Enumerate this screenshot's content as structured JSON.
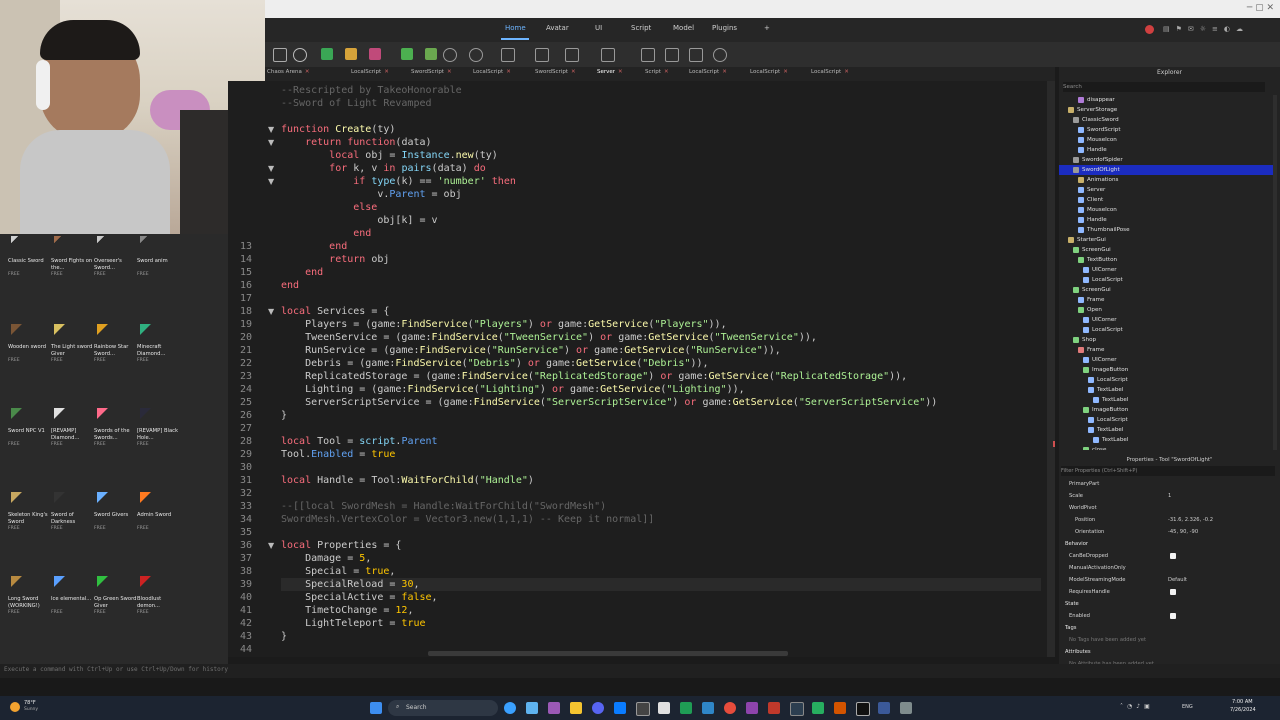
{
  "menu": {
    "items": [
      "Home",
      "Avatar",
      "UI",
      "Script",
      "Model",
      "Plugins",
      "+"
    ]
  },
  "tabs": [
    {
      "label": "Chaos Arena"
    },
    {
      "label": "LocalScript"
    },
    {
      "label": "SwordScript"
    },
    {
      "label": "LocalScript"
    },
    {
      "label": "SwordScript"
    },
    {
      "label": "Server"
    },
    {
      "label": "Script"
    },
    {
      "label": "LocalScript"
    },
    {
      "label": "LocalScript"
    },
    {
      "label": "LocalScript"
    }
  ],
  "toolbox": {
    "free_label": "FREE",
    "items": [
      {
        "name": "Classic Sword"
      },
      {
        "name": "Sword Fights on the..."
      },
      {
        "name": "Overseer's Sword..."
      },
      {
        "name": "Sword anim"
      },
      {
        "name": "Wooden sword"
      },
      {
        "name": "The Light sword Giver"
      },
      {
        "name": "Rainbow Star Sword..."
      },
      {
        "name": "Minecraft Diamond..."
      },
      {
        "name": "Sword NPC V1"
      },
      {
        "name": "[REVAMP] Diamond..."
      },
      {
        "name": "Swords of the Swords..."
      },
      {
        "name": "[REVAMP] Black Hole..."
      },
      {
        "name": "Skeleton King's Sword"
      },
      {
        "name": "Sword of Darkness"
      },
      {
        "name": "Sword Givers"
      },
      {
        "name": "Admin Sword"
      },
      {
        "name": "Long Sword (WORKING!)"
      },
      {
        "name": "Ice elemental..."
      },
      {
        "name": "Op Green Sword Giver"
      },
      {
        "name": "Bloodlust demon..."
      }
    ]
  },
  "code": {
    "lines": [
      {
        "n": "",
        "html": "<span class='cmt'>--Rescripted by TakeoHonorable</span>"
      },
      {
        "n": "",
        "html": "<span class='cmt'>--Sword of Light Revamped</span>"
      },
      {
        "n": "",
        "html": ""
      },
      {
        "n": "",
        "html": "<span class='kw'>function</span> <span class='fn'>Create</span>(ty)"
      },
      {
        "n": "",
        "html": "    <span class='kw'>return</span> <span class='kw'>function</span>(data)"
      },
      {
        "n": "",
        "html": "        <span class='kw'>local</span> obj = <span class='bi'>Instance</span>.<span class='fn'>new</span>(ty)"
      },
      {
        "n": "",
        "html": "        <span class='kw'>for</span> k, v <span class='kw'>in</span> <span class='bi'>pairs</span>(data) <span class='kw'>do</span>"
      },
      {
        "n": "",
        "html": "            <span class='kw'>if</span> <span class='bi'>type</span>(k) == <span class='str'>'number'</span> <span class='kw'>then</span>"
      },
      {
        "n": "",
        "html": "                v.<span class='prop'>Parent</span> = obj"
      },
      {
        "n": "",
        "html": "            <span class='kw'>else</span>"
      },
      {
        "n": "",
        "html": "                obj[k] = v"
      },
      {
        "n": "",
        "html": "            <span class='kw'>end</span>"
      },
      {
        "n": "13",
        "html": "        <span class='kw'>end</span>"
      },
      {
        "n": "14",
        "html": "        <span class='kw'>return</span> obj"
      },
      {
        "n": "15",
        "html": "    <span class='kw'>end</span>"
      },
      {
        "n": "16",
        "html": "<span class='kw'>end</span>"
      },
      {
        "n": "17",
        "html": ""
      },
      {
        "n": "18",
        "html": "<span class='kw'>local</span> Services = {"
      },
      {
        "n": "19",
        "html": "    Players = (game:<span class='fn'>FindService</span>(<span class='str'>\"Players\"</span>) <span class='kw'>or</span> game:<span class='fn'>GetService</span>(<span class='str'>\"Players\"</span>)),"
      },
      {
        "n": "20",
        "html": "    TweenService = (game:<span class='fn'>FindService</span>(<span class='str'>\"TweenService\"</span>) <span class='kw'>or</span> game:<span class='fn'>GetService</span>(<span class='str'>\"TweenService\"</span>)),"
      },
      {
        "n": "21",
        "html": "    RunService = (game:<span class='fn'>FindService</span>(<span class='str'>\"RunService\"</span>) <span class='kw'>or</span> game:<span class='fn'>GetService</span>(<span class='str'>\"RunService\"</span>)),"
      },
      {
        "n": "22",
        "html": "    Debris = (game:<span class='fn'>FindService</span>(<span class='str'>\"Debris\"</span>) <span class='kw'>or</span> game:<span class='fn'>GetService</span>(<span class='str'>\"Debris\"</span>)),"
      },
      {
        "n": "23",
        "html": "    ReplicatedStorage = (game:<span class='fn'>FindService</span>(<span class='str'>\"ReplicatedStorage\"</span>) <span class='kw'>or</span> game:<span class='fn'>GetService</span>(<span class='str'>\"ReplicatedStorage\"</span>)),"
      },
      {
        "n": "24",
        "html": "    Lighting = (game:<span class='fn'>FindService</span>(<span class='str'>\"Lighting\"</span>) <span class='kw'>or</span> game:<span class='fn'>GetService</span>(<span class='str'>\"Lighting\"</span>)),"
      },
      {
        "n": "25",
        "html": "    ServerScriptService = (game:<span class='fn'>FindService</span>(<span class='str'>\"ServerScriptService\"</span>) <span class='kw'>or</span> game:<span class='fn'>GetService</span>(<span class='str'>\"ServerScriptService\"</span>))"
      },
      {
        "n": "26",
        "html": "}"
      },
      {
        "n": "27",
        "html": ""
      },
      {
        "n": "28",
        "html": "<span class='kw'>local</span> Tool = <span class='bi'>script</span>.<span class='prop'>Parent</span>"
      },
      {
        "n": "29",
        "html": "Tool.<span class='prop'>Enabled</span> = <span class='bool'>true</span>"
      },
      {
        "n": "30",
        "html": ""
      },
      {
        "n": "31",
        "html": "<span class='kw'>local</span> Handle = Tool:<span class='fn'>WaitForChild</span>(<span class='str'>\"Handle\"</span>)"
      },
      {
        "n": "32",
        "html": ""
      },
      {
        "n": "33",
        "html": "<span class='cmt'>--[[local SwordMesh = Handle:WaitForChild(\"SwordMesh\")</span>"
      },
      {
        "n": "34",
        "html": "<span class='cmt'>SwordMesh.VertexColor = Vector3.new(1,1,1) -- Keep it normal]]</span>"
      },
      {
        "n": "35",
        "html": ""
      },
      {
        "n": "36",
        "html": "<span class='kw'>local</span> Properties = {"
      },
      {
        "n": "37",
        "html": "    Damage = <span class='num'>5</span>,"
      },
      {
        "n": "38",
        "html": "    Special = <span class='bool'>true</span>,"
      },
      {
        "n": "39",
        "html": "    SpecialReload = <span class='num'>30</span>,"
      },
      {
        "n": "40",
        "html": "    SpecialActive = <span class='bool'>false</span>,"
      },
      {
        "n": "41",
        "html": "    TimetoChange = <span class='num'>12</span>,"
      },
      {
        "n": "42",
        "html": "    LightTeleport = <span class='bool'>true</span>"
      },
      {
        "n": "43",
        "html": "}"
      },
      {
        "n": "44",
        "html": ""
      }
    ]
  },
  "explorer": {
    "title": "Explorer",
    "search_placeholder": "Search",
    "rows": [
      {
        "label": "disappear",
        "indent": 3,
        "color": "#b07bd8"
      },
      {
        "label": "ServerStorage",
        "indent": 1,
        "color": "#c8b06a"
      },
      {
        "label": "ClassicSword",
        "indent": 2,
        "color": "#9a9a9a"
      },
      {
        "label": "SwordScript",
        "indent": 3,
        "color": "#8fb8ff"
      },
      {
        "label": "MouseIcon",
        "indent": 3,
        "color": "#8fb8ff"
      },
      {
        "label": "Handle",
        "indent": 3,
        "color": "#8fb8ff"
      },
      {
        "label": "SwordofSpider",
        "indent": 2,
        "color": "#9a9a9a"
      },
      {
        "label": "SwordOfLight",
        "indent": 2,
        "color": "#9a9a9a",
        "selected": true
      },
      {
        "label": "Animations",
        "indent": 3,
        "color": "#c8b06a"
      },
      {
        "label": "Server",
        "indent": 3,
        "color": "#8fb8ff"
      },
      {
        "label": "Client",
        "indent": 3,
        "color": "#8fb8ff"
      },
      {
        "label": "MouseIcon",
        "indent": 3,
        "color": "#8fb8ff"
      },
      {
        "label": "Handle",
        "indent": 3,
        "color": "#8fb8ff"
      },
      {
        "label": "ThumbnailPose",
        "indent": 3,
        "color": "#8fb8ff"
      },
      {
        "label": "StarterGui",
        "indent": 1,
        "color": "#c8b06a"
      },
      {
        "label": "ScreenGui",
        "indent": 2,
        "color": "#7fd17f"
      },
      {
        "label": "TextButton",
        "indent": 3,
        "color": "#7fd17f"
      },
      {
        "label": "UICorner",
        "indent": 4,
        "color": "#8fb8ff"
      },
      {
        "label": "LocalScript",
        "indent": 4,
        "color": "#8fb8ff"
      },
      {
        "label": "ScreenGui",
        "indent": 2,
        "color": "#7fd17f"
      },
      {
        "label": "Frame",
        "indent": 3,
        "color": "#8fb8ff"
      },
      {
        "label": "Open",
        "indent": 3,
        "color": "#7fd17f"
      },
      {
        "label": "UICorner",
        "indent": 4,
        "color": "#8fb8ff"
      },
      {
        "label": "LocalScript",
        "indent": 4,
        "color": "#8fb8ff"
      },
      {
        "label": "Shop",
        "indent": 2,
        "color": "#7fd17f"
      },
      {
        "label": "Frame",
        "indent": 3,
        "color": "#e07b7b"
      },
      {
        "label": "UICorner",
        "indent": 4,
        "color": "#8fb8ff"
      },
      {
        "label": "ImageButton",
        "indent": 4,
        "color": "#7fd17f"
      },
      {
        "label": "LocalScript",
        "indent": 5,
        "color": "#8fb8ff"
      },
      {
        "label": "TextLabel",
        "indent": 5,
        "color": "#8fb8ff"
      },
      {
        "label": "TextLabel",
        "indent": 6,
        "color": "#8fb8ff"
      },
      {
        "label": "ImageButton",
        "indent": 4,
        "color": "#7fd17f"
      },
      {
        "label": "LocalScript",
        "indent": 5,
        "color": "#8fb8ff"
      },
      {
        "label": "TextLabel",
        "indent": 5,
        "color": "#8fb8ff"
      },
      {
        "label": "TextLabel",
        "indent": 6,
        "color": "#8fb8ff"
      },
      {
        "label": "close",
        "indent": 4,
        "color": "#7fd17f"
      }
    ]
  },
  "properties": {
    "title": "Properties - Tool \"SwordOfLight\"",
    "filter_placeholder": "Filter Properties (Ctrl+Shift+P)",
    "rows": [
      {
        "label": "PrimaryPart",
        "value": "",
        "type": "text"
      },
      {
        "label": "Scale",
        "value": "1",
        "type": "text"
      },
      {
        "label": "WorldPivot",
        "value": "",
        "type": "section-sub"
      },
      {
        "label": "Position",
        "value": "-31.6, 2.326, -0.2",
        "type": "text",
        "indent": true
      },
      {
        "label": "Orientation",
        "value": "-45, 90, -90",
        "type": "text",
        "indent": true
      },
      {
        "label": "Behavior",
        "value": "",
        "type": "section"
      },
      {
        "label": "CanBeDropped",
        "value": "",
        "type": "check"
      },
      {
        "label": "ManualActivationOnly",
        "value": "",
        "type": "text"
      },
      {
        "label": "ModelStreamingMode",
        "value": "Default",
        "type": "text"
      },
      {
        "label": "RequiresHandle",
        "value": "",
        "type": "check"
      },
      {
        "label": "State",
        "value": "",
        "type": "section"
      },
      {
        "label": "Enabled",
        "value": "",
        "type": "check"
      },
      {
        "label": "Tags",
        "value": "",
        "type": "section"
      },
      {
        "label": "No Tags have been added yet",
        "value": "",
        "type": "muted"
      },
      {
        "label": "Attributes",
        "value": "",
        "type": "section"
      },
      {
        "label": "No Attribute has been added yet",
        "value": "",
        "type": "muted"
      }
    ]
  },
  "command_bar": {
    "placeholder": "Execute a command with Ctrl+Up or use Ctrl+Up/Down for history"
  },
  "taskbar": {
    "weather": "78°F",
    "weather_sub": "Sunny",
    "search_label": "Search",
    "lang": "ENG",
    "time": "7:00 AM",
    "date": "7/26/2024"
  }
}
